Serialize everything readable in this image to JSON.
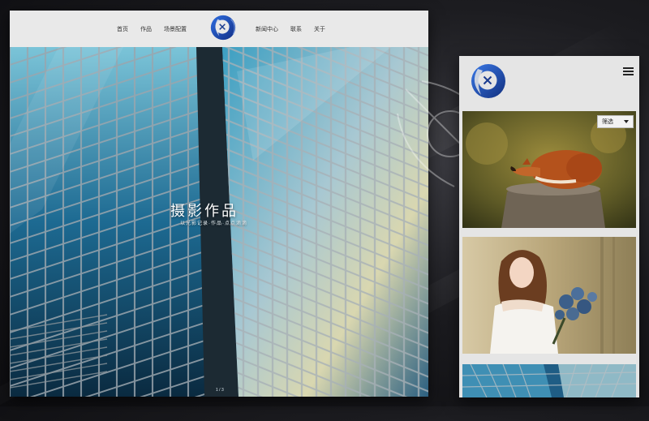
{
  "desktop": {
    "nav_left": [
      "首页",
      "作品",
      "场景配置"
    ],
    "nav_right": [
      "新闻中心",
      "联系",
      "关于"
    ],
    "hero": {
      "title": "摄影作品",
      "subtitle": "以光影记录·作品·点点滴滴",
      "pager": "1 / 3"
    }
  },
  "mobile": {
    "filter_label": "筛选"
  },
  "colors": {
    "brand_blue": "#2a55b8",
    "brand_dark_blue": "#14307a",
    "header_bg": "#e9e9e9"
  },
  "icons": [
    "logo-icon",
    "menu-icon",
    "chevron-down-icon"
  ]
}
